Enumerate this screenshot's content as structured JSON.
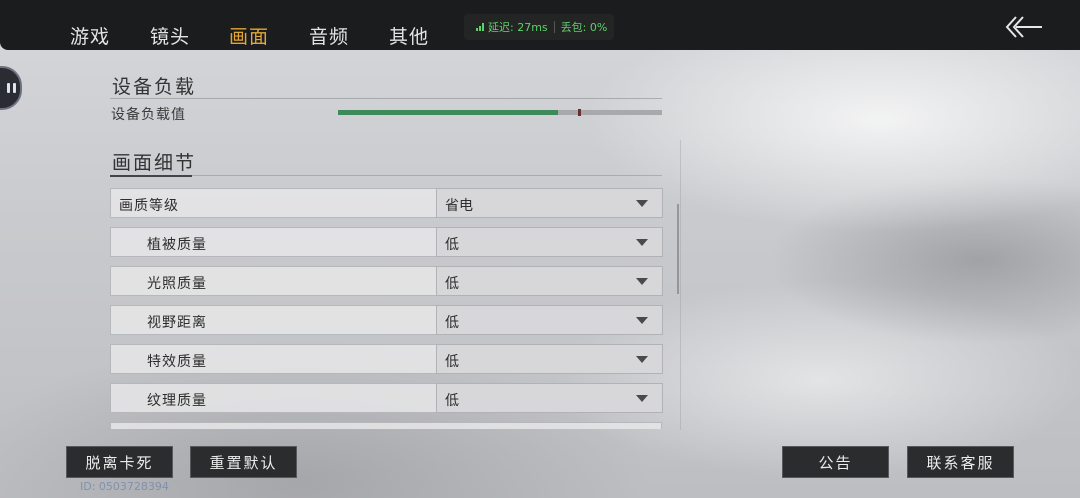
{
  "nav": {
    "tabs": [
      {
        "label": "游戏",
        "active": false
      },
      {
        "label": "镜头",
        "active": false
      },
      {
        "label": "画面",
        "active": true
      },
      {
        "label": "音频",
        "active": false
      },
      {
        "label": "其他",
        "active": false
      }
    ],
    "latency": "延迟: 27ms",
    "packet_loss": "丢包: 0%"
  },
  "device_load": {
    "title": "设备负载",
    "label": "设备负载值",
    "level": 0.68,
    "marker": 0.74
  },
  "graphics": {
    "title": "画面细节",
    "settings": [
      {
        "label": "画质等级",
        "value": "省电"
      },
      {
        "label": "植被质量",
        "value": "低"
      },
      {
        "label": "光照质量",
        "value": "低"
      },
      {
        "label": "视野距离",
        "value": "低"
      },
      {
        "label": "特效质量",
        "value": "低"
      },
      {
        "label": "纹理质量",
        "value": "低"
      }
    ]
  },
  "buttons": {
    "unstuck": "脱离卡死",
    "reset_default": "重置默认",
    "announcement": "公告",
    "contact_support": "联系客服"
  },
  "uid": "ID: 0503728394",
  "colors": {
    "active_tab": "#e0a638",
    "load_bar": "#3f8a5a",
    "net_status": "#5fcf6c"
  }
}
